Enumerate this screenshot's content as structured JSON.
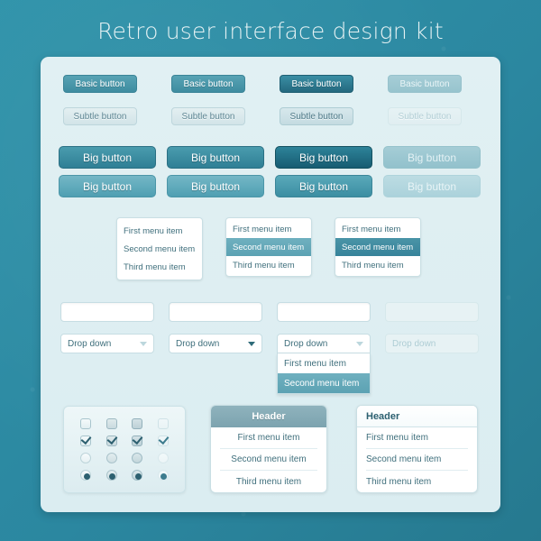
{
  "page": {
    "title": "Retro user interface design kit",
    "background_color": "#2d8ca3",
    "card_color": "#dcedf1"
  },
  "buttons": {
    "basic_label": "Basic button",
    "subtle_label": "Subtle button",
    "big_label": "Big button",
    "states": [
      "normal",
      "hover",
      "active",
      "disabled"
    ],
    "basic_row": [
      "Basic button",
      "Basic button",
      "Basic button",
      "Basic button"
    ],
    "subtle_row": [
      "Subtle button",
      "Subtle button",
      "Subtle button",
      "Subtle button"
    ],
    "big_dark_row": [
      "Big button",
      "Big button",
      "Big button",
      "Big button"
    ],
    "big_light_row": [
      "Big button",
      "Big button",
      "Big button",
      "Big button"
    ]
  },
  "menu": {
    "items": [
      "First menu item",
      "Second menu item",
      "Third menu item"
    ],
    "selected_item": "Second menu item",
    "highlight_mid_color": "#5ca2b3",
    "highlight_dark_color": "#37839a"
  },
  "inputs": {
    "text_value": "",
    "text_placeholder": "",
    "dropdown_label": "Drop down",
    "dropdown_open_items": [
      "First menu item",
      "Second menu item"
    ],
    "dropdown_selected": "Second menu item"
  },
  "toggles": {
    "checkbox_unchecked_label": "checkbox unchecked",
    "checkbox_checked_label": "checkbox checked",
    "radio_unselected_label": "radio unselected",
    "radio_selected_label": "radio selected"
  },
  "panels": {
    "header_label": "Header",
    "items": [
      "First menu item",
      "Second menu item",
      "Third menu item"
    ]
  }
}
